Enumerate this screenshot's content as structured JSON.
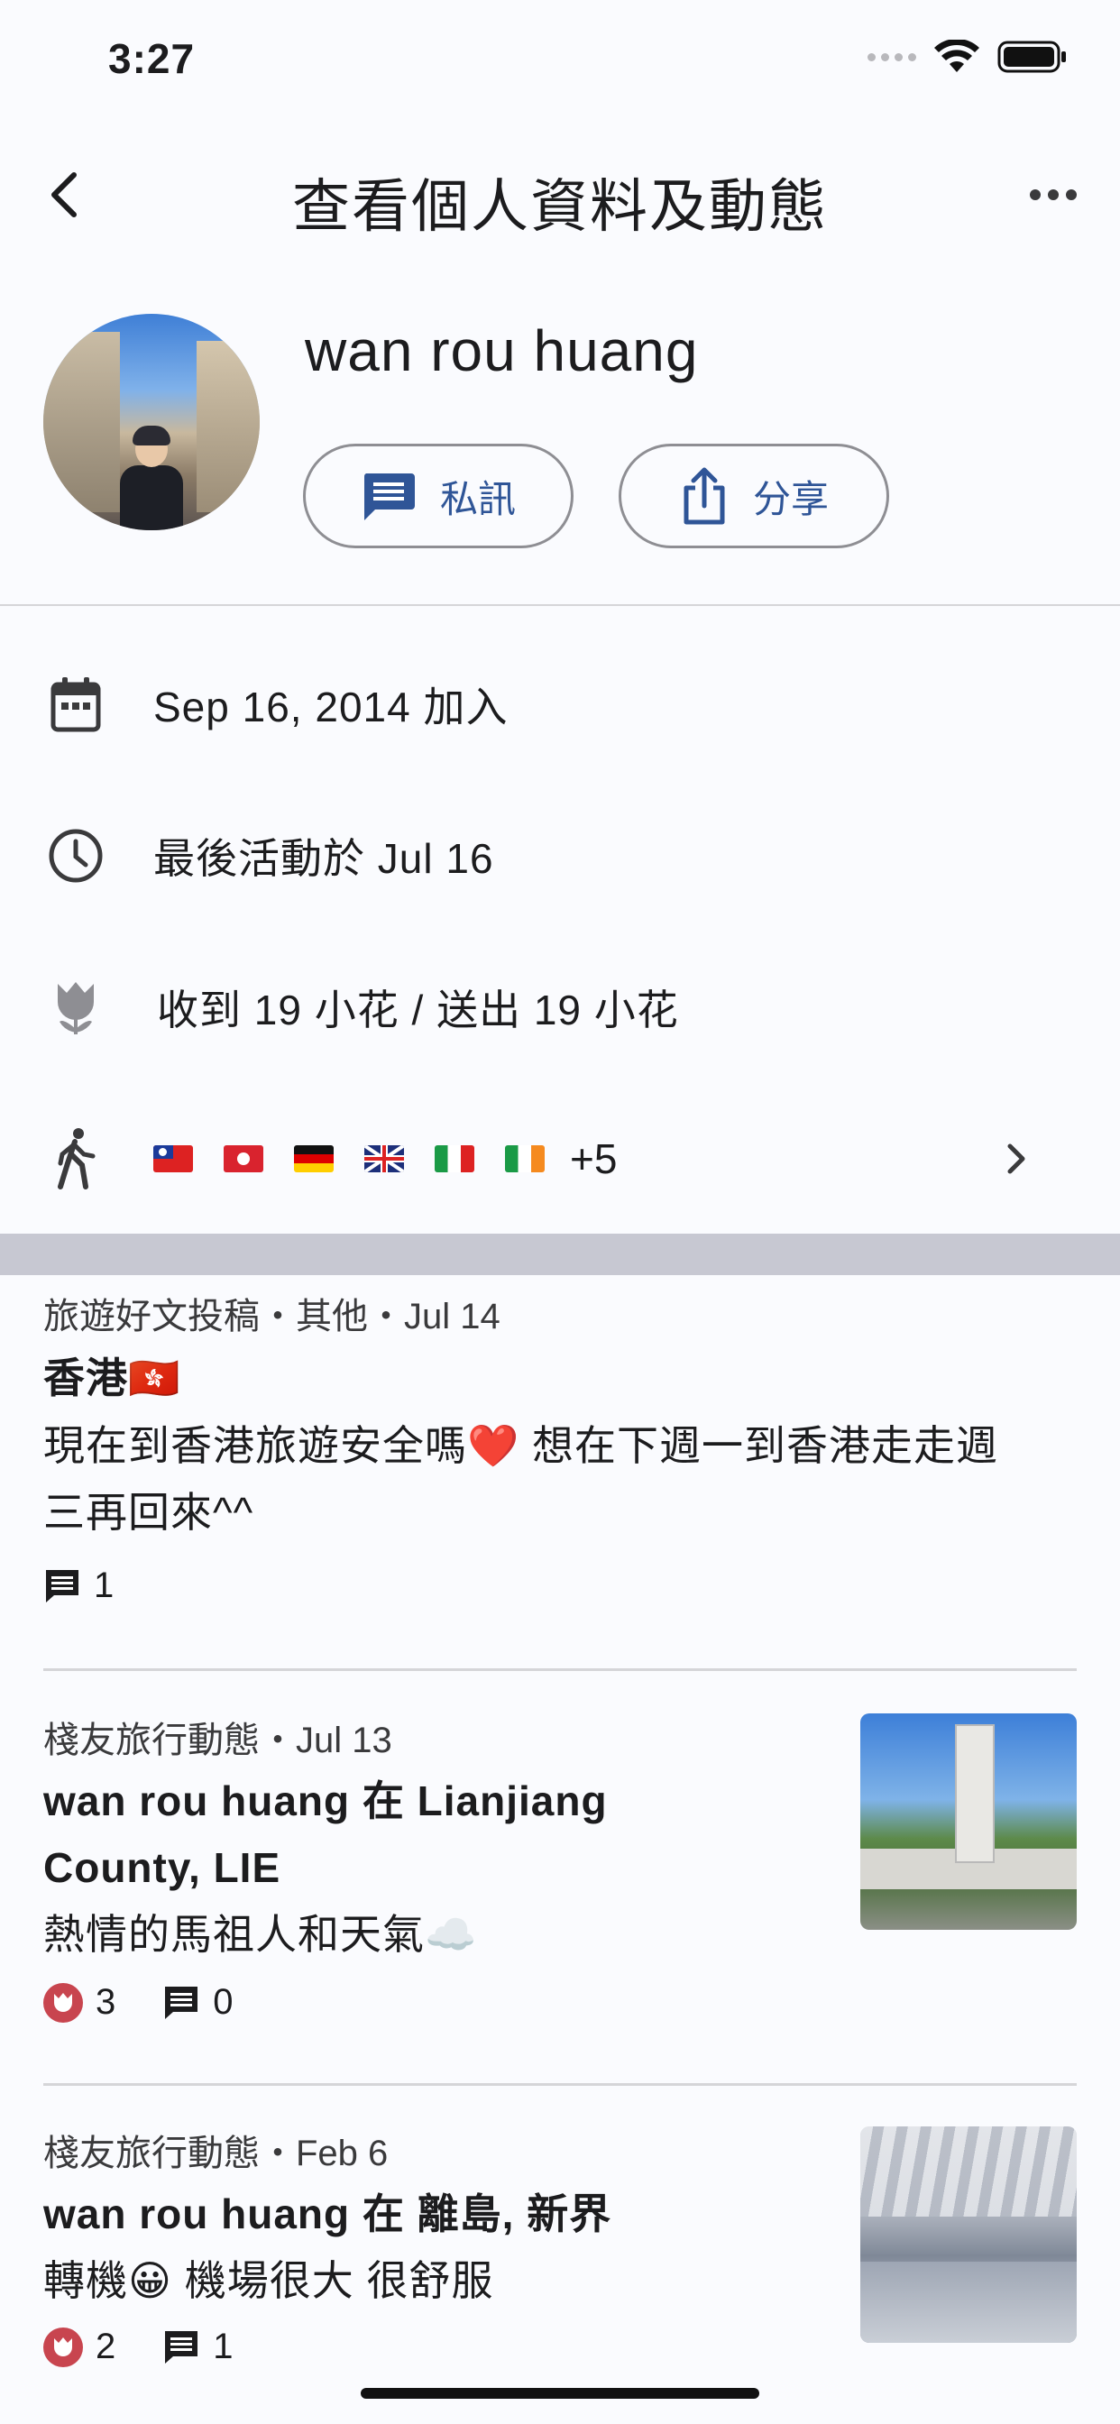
{
  "status_bar": {
    "time": "3:27"
  },
  "nav": {
    "title": "查看個人資料及動態"
  },
  "profile": {
    "name": "wan rou huang",
    "message_button": "私訊",
    "share_button": "分享"
  },
  "info": {
    "joined": "Sep 16, 2014 加入",
    "last_active": "最後活動於 Jul 16",
    "flowers": "收到 19 小花 / 送出 19 小花",
    "visited_more": "+5"
  },
  "posts": [
    {
      "meta": "旅遊好文投稿・其他・Jul 14",
      "title": "香港🇭🇰",
      "body_line1": "現在到香港旅遊安全嗎❤️ 想在下週一到香港走走週",
      "body_line2": "三再回來^^",
      "comments": "1"
    },
    {
      "meta": "棧友旅行動態・Jul 13",
      "title_line1": "wan rou huang 在 Lianjiang",
      "title_line2": "County, LIE",
      "body": "熱情的馬祖人和天氣☁️",
      "flowers": "3",
      "comments": "0"
    },
    {
      "meta": "棧友旅行動態・Feb 6",
      "title": "wan rou huang 在 離島, 新界",
      "body": "轉機😀  機場很大 很舒服",
      "flowers": "2",
      "comments": "1"
    }
  ],
  "colors": {
    "accent": "#2f5597",
    "flower_badge": "#c8454f",
    "band": "#c7c8d2"
  }
}
